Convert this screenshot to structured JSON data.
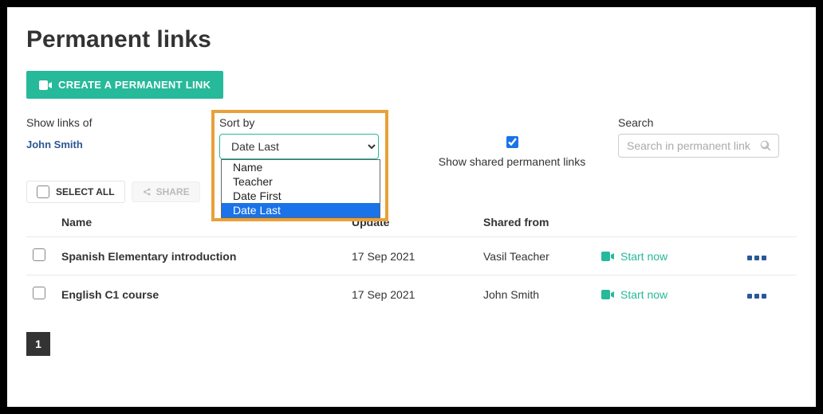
{
  "title": "Permanent links",
  "create_button": "CREATE A PERMANENT LINK",
  "filters": {
    "show_links_of_label": "Show links of",
    "user": "John Smith",
    "sort_by_label": "Sort by",
    "sort_selected": "Date Last",
    "sort_options": [
      "Name",
      "Teacher",
      "Date First",
      "Date Last"
    ],
    "shared_checkbox_checked": true,
    "shared_label": "Show shared permanent links",
    "search_label": "Search",
    "search_placeholder": "Search in permanent link"
  },
  "bulk": {
    "select_all": "SELECT ALL",
    "share": "SHARE"
  },
  "table": {
    "headers": {
      "name": "Name",
      "update": "Update",
      "shared_from": "Shared from"
    },
    "rows": [
      {
        "name": "Spanish Elementary introduction",
        "date": "17 Sep 2021",
        "shared_from": "Vasil Teacher",
        "start": "Start now"
      },
      {
        "name": "English C1 course",
        "date": "17 Sep 2021",
        "shared_from": "John Smith",
        "start": "Start now"
      }
    ]
  },
  "pagination": {
    "current": "1"
  }
}
